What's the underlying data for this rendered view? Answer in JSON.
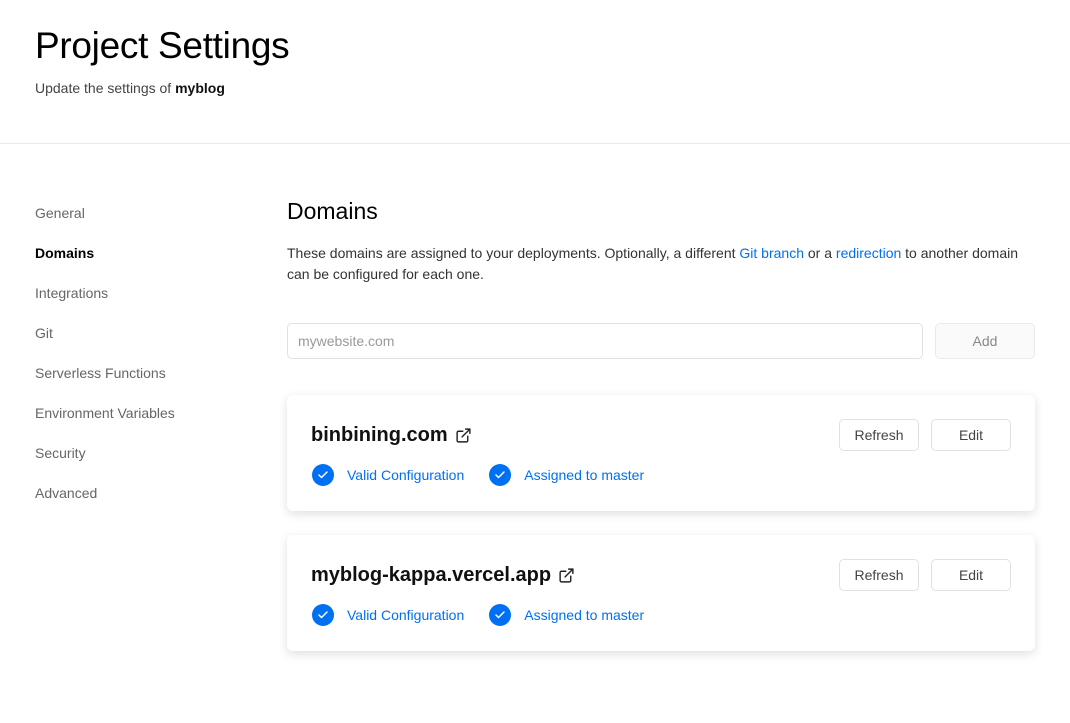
{
  "header": {
    "title": "Project Settings",
    "subtitle_prefix": "Update the settings of",
    "project_name": "myblog"
  },
  "sidebar": {
    "items": [
      {
        "label": "General"
      },
      {
        "label": "Domains",
        "active": true
      },
      {
        "label": "Integrations"
      },
      {
        "label": "Git"
      },
      {
        "label": "Serverless Functions"
      },
      {
        "label": "Environment Variables"
      },
      {
        "label": "Security"
      },
      {
        "label": "Advanced"
      }
    ]
  },
  "domains": {
    "title": "Domains",
    "description": {
      "part1": "These domains are assigned to your deployments. Optionally, a different ",
      "link1": "Git branch",
      "part2": " or a ",
      "link2": "redirection",
      "part3": " to another domain can be configured for each one."
    },
    "input_placeholder": "mywebsite.com",
    "input_value": "",
    "add_label": "Add",
    "list": [
      {
        "name": "binbining.com",
        "refresh_label": "Refresh",
        "edit_label": "Edit",
        "status1": "Valid Configuration",
        "status2": "Assigned to master"
      },
      {
        "name": "myblog-kappa.vercel.app",
        "refresh_label": "Refresh",
        "edit_label": "Edit",
        "status1": "Valid Configuration",
        "status2": "Assigned to master"
      }
    ]
  },
  "colors": {
    "accent": "#0070f3",
    "muted_text": "#666666",
    "border": "#eaeaea"
  },
  "icons": {
    "external": "external-link-icon",
    "check": "check-circle-icon"
  }
}
